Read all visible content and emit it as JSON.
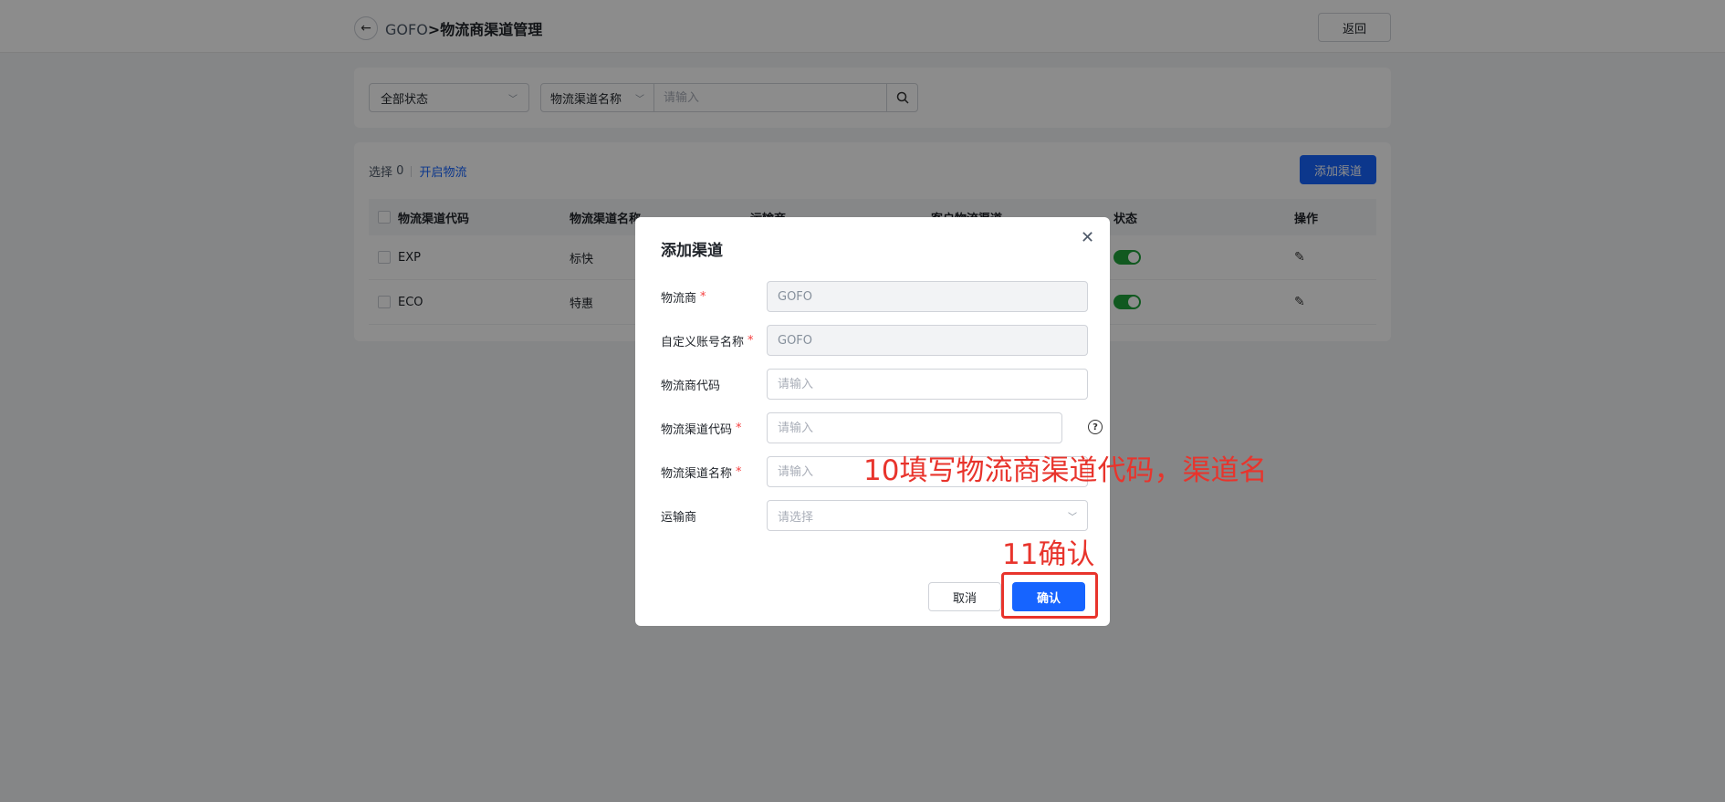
{
  "header": {
    "back_icon": "arrow-left-icon",
    "breadcrumb_link": "GOFO",
    "breadcrumb_sep": ">",
    "breadcrumb_current": "物流商渠道管理",
    "return_label": "返回"
  },
  "filter": {
    "status_value": "全部状态",
    "field_value": "物流渠道名称",
    "search_placeholder": "请输入"
  },
  "table": {
    "selected_label": "选择",
    "selected_count": "0",
    "open_logistics_label": "开启物流",
    "add_channel_label": "添加渠道",
    "columns": [
      "物流渠道代码",
      "物流渠道名称",
      "运输商",
      "客户物流渠道",
      "状态",
      "操作"
    ],
    "rows": [
      {
        "code": "EXP",
        "name": "标快",
        "status_on": true
      },
      {
        "code": "ECO",
        "name": "特惠",
        "status_on": true
      }
    ]
  },
  "modal": {
    "title": "添加渠道",
    "fields": {
      "carrier": {
        "label": "物流商",
        "value": "GOFO"
      },
      "account_name": {
        "label": "自定义账号名称",
        "value": "GOFO"
      },
      "carrier_code": {
        "label": "物流商代码",
        "placeholder": "请输入"
      },
      "channel_code": {
        "label": "物流渠道代码",
        "placeholder": "请输入"
      },
      "channel_name": {
        "label": "物流渠道名称",
        "placeholder": "请输入"
      },
      "transporter": {
        "label": "运输商",
        "placeholder": "请选择"
      }
    },
    "required_mark": "*",
    "cancel_label": "取消",
    "confirm_label": "确认"
  },
  "annotations": {
    "step10": "10填写物流商渠道代码，渠道名",
    "step11": "11确认"
  },
  "colors": {
    "primary": "#1664ff",
    "annotation_red": "#e8342c",
    "toggle_on": "#1fa33b"
  }
}
